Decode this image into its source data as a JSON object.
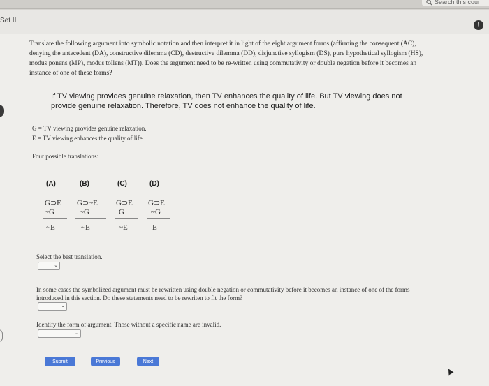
{
  "header": {
    "search_text": "Search this cour",
    "set_label": "Set II",
    "info_icon": "!"
  },
  "question": {
    "intro_lines": [
      "Translate the following argument into symbolic notation and then interpret it in light of the eight argument forms (affirming the consequent (AC),",
      "denying the antecedent (DA), constructive dilemma (CD), destructive dilemma (DD), disjunctive syllogism (DS), pure hypothetical syllogism (HS),",
      "modus ponens (MP), modus tollens (MT)). Does the argument need to be re-written using commutativity or double negation before it becomes an",
      "instance of one of these forms?"
    ],
    "argument_lines": [
      "If TV viewing provides genuine relaxation, then TV enhances the quality of life. But TV viewing does not",
      "provide genuine relaxation. Therefore, TV does not enhance the quality of life."
    ],
    "def_g": "G = TV viewing provides genuine relaxation.",
    "def_e": "E = TV viewing enhances the quality of life.",
    "four_label": "Four possible translations:"
  },
  "options": [
    {
      "label": "(A)",
      "p1": "G⊃E",
      "p2": "~G",
      "concl": "~E"
    },
    {
      "label": "(B)",
      "p1": "G⊃~E",
      "p2": "~G",
      "concl": "~E"
    },
    {
      "label": "(C)",
      "p1": "G⊃E",
      "p2": "G",
      "concl": "~E"
    },
    {
      "label": "(D)",
      "p1": "G⊃E",
      "p2": "~G",
      "concl": "E"
    }
  ],
  "prompts": {
    "select_best": "Select the best translation.",
    "rewrite_1": "In some cases the symbolized argument must be rewritten using double negation or commutativity before it becomes an instance of one of the forms",
    "rewrite_2": "introduced in this section. Do these statements need to be rewriten to fit the form?",
    "identify": "Identify the form of argument. Those without a specific name are invalid."
  },
  "buttons": {
    "submit": "Submit",
    "previous": "Previous",
    "next": "Next"
  },
  "colors": {
    "button_blue": "#4a78d6"
  }
}
